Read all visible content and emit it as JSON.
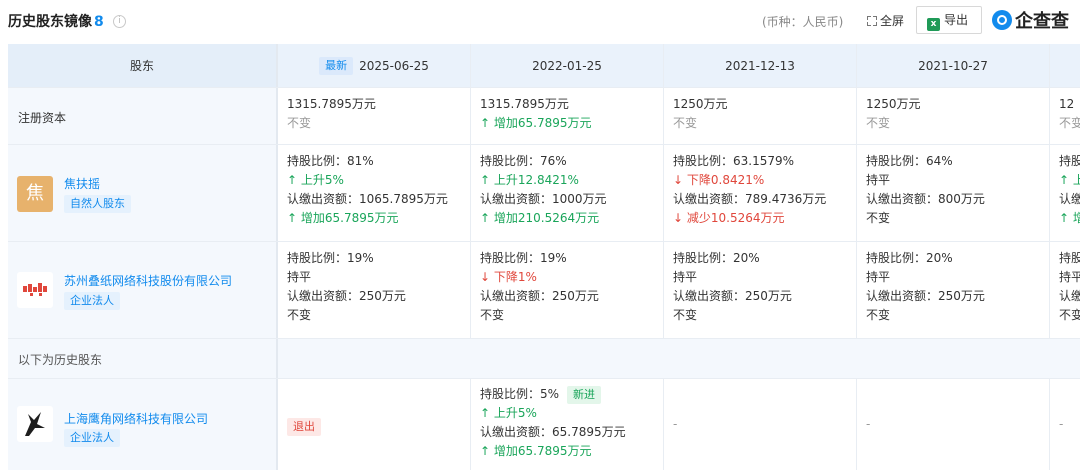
{
  "header": {
    "title": "历史股东镜像",
    "count": "8",
    "info_icon": "info-circle-icon",
    "currency": "(币种：人民币)",
    "fullscreen": "全屏",
    "export": "导出",
    "brand": "企查查"
  },
  "table": {
    "columns": [
      {
        "date": "2025-06-25",
        "tag": "最新"
      },
      {
        "date": "2022-01-25"
      },
      {
        "date": "2021-12-13"
      },
      {
        "date": "2021-10-27"
      }
    ],
    "header_label": "股东",
    "registered_capital": {
      "label": "注册资本",
      "values": [
        {
          "main": "1315.7895万元",
          "change": "不变",
          "dir": "none"
        },
        {
          "main": "1315.7895万元",
          "change": "↑ 增加65.7895万元",
          "dir": "up"
        },
        {
          "main": "1250万元",
          "change": "不变",
          "dir": "none"
        },
        {
          "main": "1250万元",
          "change": "不变",
          "dir": "none"
        },
        {
          "main": "12",
          "change": "不变",
          "dir": "none"
        }
      ]
    },
    "shareholders": [
      {
        "name": "焦扶摇",
        "type": "自然人股东",
        "avatar_char": "焦",
        "cells": [
          {
            "ratio": "持股比例：81%",
            "ratio_change": "↑ 上升5%",
            "ratio_dir": "up",
            "amount": "认缴出资额：1065.7895万元",
            "amount_change": "↑ 增加65.7895万元",
            "amount_dir": "up"
          },
          {
            "ratio": "持股比例：76%",
            "ratio_change": "↑ 上升12.8421%",
            "ratio_dir": "up",
            "amount": "认缴出资额：1000万元",
            "amount_change": "↑ 增加210.5264万元",
            "amount_dir": "up"
          },
          {
            "ratio": "持股比例：63.1579%",
            "ratio_change": "↓ 下降0.8421%",
            "ratio_dir": "down",
            "amount": "认缴出资额：789.4736万元",
            "amount_change": "↓ 减少10.5264万元",
            "amount_dir": "down"
          },
          {
            "ratio": "持股比例：64%",
            "ratio_change": "持平",
            "ratio_dir": "none",
            "amount": "认缴出资额：800万元",
            "amount_change": "不变",
            "amount_dir": "none"
          },
          {
            "ratio": "持股",
            "ratio_change": "↑ 上",
            "ratio_dir": "up",
            "amount": "认缴",
            "amount_change": "↑ 增",
            "amount_dir": "up"
          }
        ]
      },
      {
        "name": "苏州叠纸网络科技股份有限公司",
        "type": "企业法人",
        "avatar_char": "",
        "cells": [
          {
            "ratio": "持股比例：19%",
            "ratio_change": "持平",
            "ratio_dir": "none",
            "amount": "认缴出资额：250万元",
            "amount_change": "不变",
            "amount_dir": "none"
          },
          {
            "ratio": "持股比例：19%",
            "ratio_change": "↓ 下降1%",
            "ratio_dir": "down",
            "amount": "认缴出资额：250万元",
            "amount_change": "不变",
            "amount_dir": "none"
          },
          {
            "ratio": "持股比例：20%",
            "ratio_change": "持平",
            "ratio_dir": "none",
            "amount": "认缴出资额：250万元",
            "amount_change": "不变",
            "amount_dir": "none"
          },
          {
            "ratio": "持股比例：20%",
            "ratio_change": "持平",
            "ratio_dir": "none",
            "amount": "认缴出资额：250万元",
            "amount_change": "不变",
            "amount_dir": "none"
          },
          {
            "ratio": "持股",
            "ratio_change": "持平",
            "ratio_dir": "none",
            "amount": "认缴",
            "amount_change": "不变",
            "amount_dir": "none"
          }
        ]
      }
    ],
    "history_label": "以下为历史股东",
    "history_shareholder": {
      "name": "上海鹰角网络科技有限公司",
      "type": "企业法人",
      "exit_tag": "退出",
      "cell2": {
        "ratio": "持股比例：5%",
        "new_tag": "新进",
        "ratio_change": "↑ 上升5%",
        "amount": "认缴出资额：65.7895万元",
        "amount_change": "↑ 增加65.7895万元"
      },
      "dash": "-"
    }
  },
  "colors": {
    "accent": "#128bed",
    "up": "#1aa55a",
    "down": "#e0473c",
    "header_bg": "#eaf2fb"
  }
}
